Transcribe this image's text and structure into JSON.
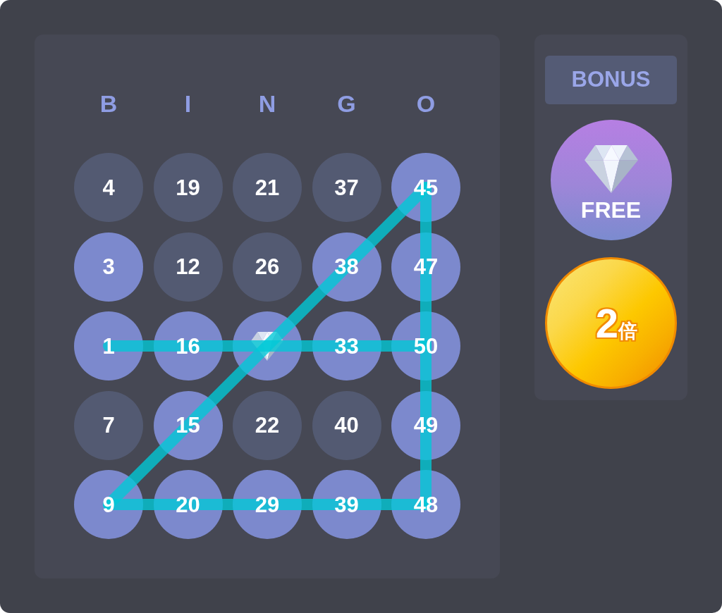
{
  "board": {
    "headers": [
      "B",
      "I",
      "N",
      "G",
      "O"
    ],
    "rows": [
      {
        "cells": [
          {
            "kind": "number",
            "label": "4",
            "marked": false
          },
          {
            "kind": "number",
            "label": "19",
            "marked": false
          },
          {
            "kind": "number",
            "label": "21",
            "marked": false
          },
          {
            "kind": "number",
            "label": "37",
            "marked": false
          },
          {
            "kind": "number",
            "label": "45",
            "marked": true
          }
        ]
      },
      {
        "cells": [
          {
            "kind": "number",
            "label": "3",
            "marked": true
          },
          {
            "kind": "number",
            "label": "12",
            "marked": false
          },
          {
            "kind": "number",
            "label": "26",
            "marked": false
          },
          {
            "kind": "number",
            "label": "38",
            "marked": true
          },
          {
            "kind": "number",
            "label": "47",
            "marked": true
          }
        ]
      },
      {
        "cells": [
          {
            "kind": "number",
            "label": "1",
            "marked": true
          },
          {
            "kind": "number",
            "label": "16",
            "marked": true
          },
          {
            "kind": "free",
            "marked": true
          },
          {
            "kind": "number",
            "label": "33",
            "marked": true
          },
          {
            "kind": "number",
            "label": "50",
            "marked": true
          }
        ]
      },
      {
        "cells": [
          {
            "kind": "number",
            "label": "7",
            "marked": false
          },
          {
            "kind": "number",
            "label": "15",
            "marked": true
          },
          {
            "kind": "number",
            "label": "22",
            "marked": false
          },
          {
            "kind": "number",
            "label": "40",
            "marked": false
          },
          {
            "kind": "number",
            "label": "49",
            "marked": true
          }
        ]
      },
      {
        "cells": [
          {
            "kind": "number",
            "label": "9",
            "marked": true
          },
          {
            "kind": "number",
            "label": "20",
            "marked": true
          },
          {
            "kind": "number",
            "label": "29",
            "marked": true
          },
          {
            "kind": "number",
            "label": "39",
            "marked": true
          },
          {
            "kind": "number",
            "label": "48",
            "marked": true
          }
        ]
      }
    ],
    "winning_lines": [
      {
        "kind": "middlerow"
      },
      {
        "kind": "antidiagonal"
      },
      {
        "kind": "rightcolumn"
      },
      {
        "kind": "bottomrow"
      }
    ]
  },
  "bonus": {
    "title": "BONUS",
    "items": [
      {
        "kind": "free",
        "label": "FREE"
      },
      {
        "kind": "multiplier",
        "number": "2",
        "unit": "倍"
      }
    ]
  }
}
